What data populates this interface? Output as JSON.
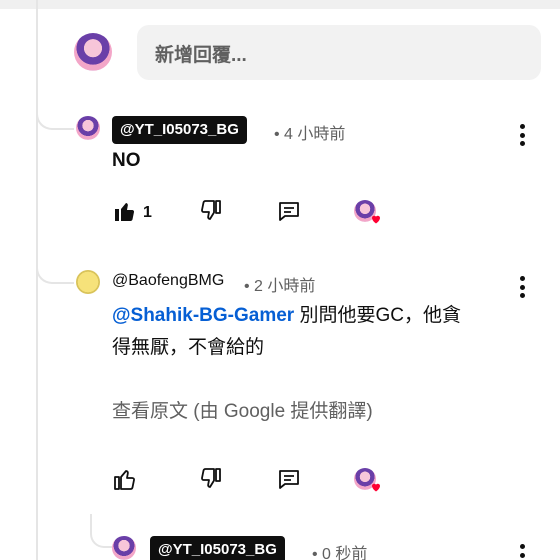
{
  "reply_input": {
    "placeholder": "新增回覆..."
  },
  "comments": [
    {
      "handle": "@YT_I05073_BG",
      "time": "• 4 小時前",
      "text": "NO",
      "likes": "1"
    },
    {
      "handle": "@BaofengBMG",
      "time": "• 2 小時前",
      "mention": "@Shahik-BG-Gamer",
      "text_line1": " 別問他要GC，他貪",
      "text_line2": "得無厭，不會給的",
      "translate": "查看原文 (由 Google 提供翻譯)"
    },
    {
      "handle": "@YT_I05073_BG",
      "time": "• 0 秒前"
    }
  ],
  "colors": {
    "accent": "#065fd4",
    "heart": "#ff0033",
    "secondary_text": "#606060"
  },
  "icons": [
    "like-icon",
    "dislike-icon",
    "reply-icon",
    "more-vert-icon",
    "heart-icon"
  ]
}
